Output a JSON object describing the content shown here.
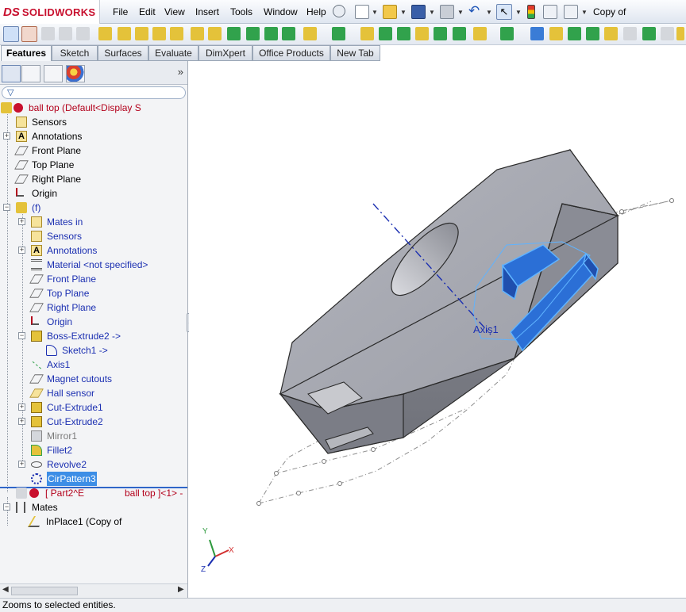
{
  "app": {
    "logo_ds": "DS",
    "logo_name": "SOLIDWORKS",
    "file_title": "Copy of"
  },
  "menu": [
    "File",
    "Edit",
    "View",
    "Insert",
    "Tools",
    "Window",
    "Help"
  ],
  "tabs": [
    {
      "label": "Features",
      "active": true
    },
    {
      "label": "Sketch",
      "active": false
    },
    {
      "label": "Surfaces",
      "active": false
    },
    {
      "label": "Evaluate",
      "active": false
    },
    {
      "label": "DimXpert",
      "active": false
    },
    {
      "label": "Office Products",
      "active": false
    },
    {
      "label": "New Tab",
      "active": false
    }
  ],
  "panel": {
    "filter_icon": "▽",
    "expand": "»"
  },
  "tree": {
    "root": "ball top  (Default<Display S",
    "sensors": "Sensors",
    "annotations": "Annotations",
    "front_plane": "Front Plane",
    "top_plane": "Top Plane",
    "right_plane": "Right Plane",
    "origin": "Origin",
    "part1": "(f)",
    "mates_in": "Mates in",
    "sub_sensors": "Sensors",
    "sub_annotations": "Annotations",
    "material": "Material <not specified>",
    "sub_front": "Front Plane",
    "sub_top": "Top Plane",
    "sub_right": "Right Plane",
    "sub_origin": "Origin",
    "boss_extrude2": "Boss-Extrude2 ->",
    "sketch1": "Sketch1 ->",
    "axis1": "Axis1",
    "magnet_cutouts": "Magnet cutouts",
    "hall_sensor": "Hall sensor",
    "cut_extrude1": "Cut-Extrude1",
    "cut_extrude2": "Cut-Extrude2",
    "mirror1": "Mirror1",
    "fillet2": "Fillet2",
    "revolve2": "Revolve2",
    "cirpattern3": "CirPattern3",
    "part2": "[ Part2^E",
    "part2_tail": "ball top ]<1> -",
    "mates": "Mates",
    "inplace1": "InPlace1 (Copy of"
  },
  "viewport": {
    "axis_label": "Axis1",
    "triad_x": "X",
    "triad_y": "Y",
    "triad_z": "Z"
  },
  "status": {
    "message": "Zooms to selected entities."
  },
  "colors": {
    "brand_red": "#c8102e",
    "selection_blue": "#3d8ee6",
    "tree_blue_text": "#1b2fb1",
    "model_gray": "#a9abb3",
    "face_highlight": "#2b6fd6"
  }
}
